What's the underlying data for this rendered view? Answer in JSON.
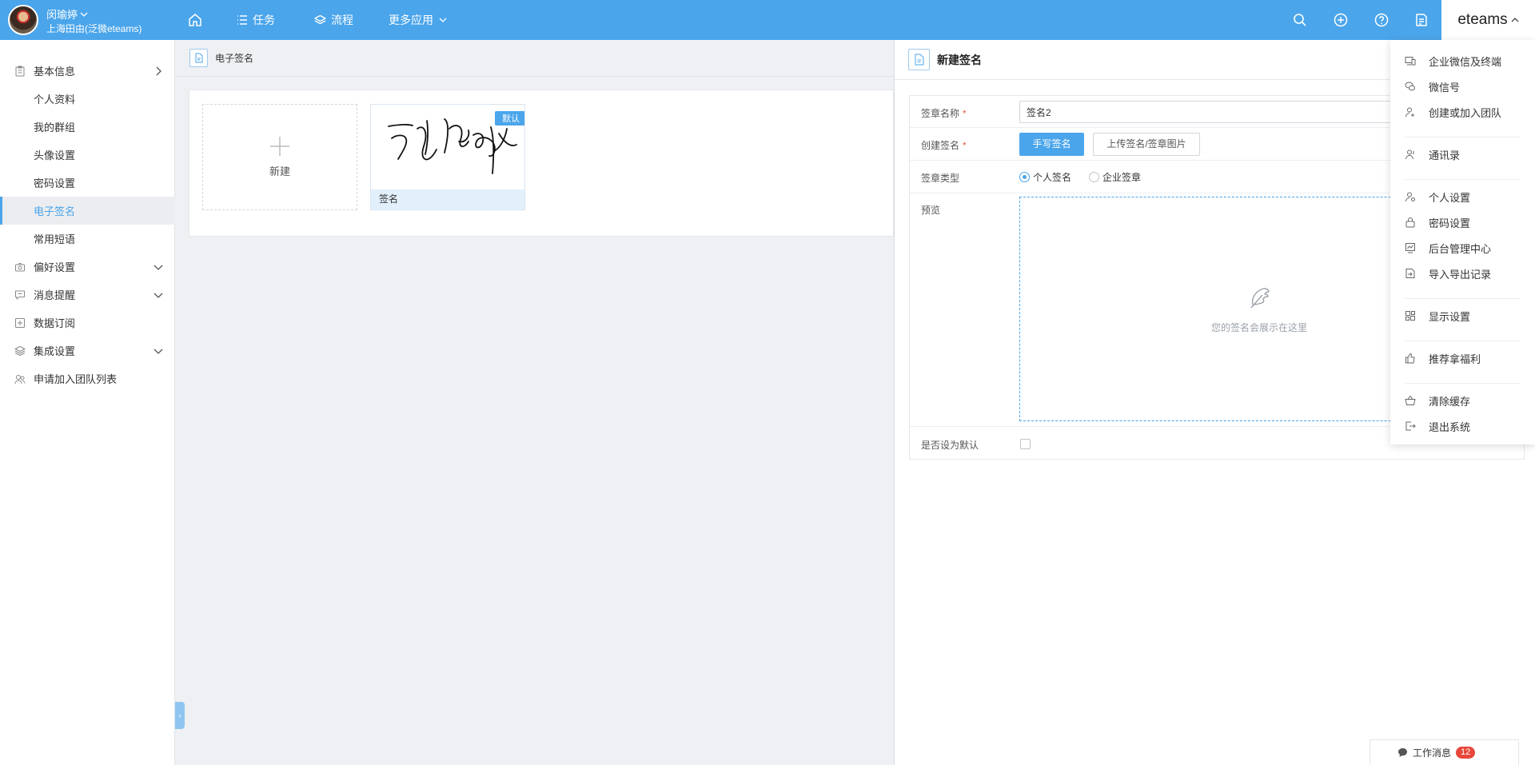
{
  "header": {
    "user_name": "闵瑜婷",
    "user_org": "上海田由(泛微eteams)",
    "nav": {
      "tasks": "任务",
      "process": "流程",
      "more_apps": "更多应用"
    },
    "brand": "eteams"
  },
  "sidebar": {
    "items": [
      {
        "label": "基本信息"
      },
      {
        "label": "个人资料"
      },
      {
        "label": "我的群组"
      },
      {
        "label": "头像设置"
      },
      {
        "label": "密码设置"
      },
      {
        "label": "电子签名"
      },
      {
        "label": "常用短语"
      },
      {
        "label": "偏好设置"
      },
      {
        "label": "消息提醒"
      },
      {
        "label": "数据订阅"
      },
      {
        "label": "集成设置"
      },
      {
        "label": "申请加入团队列表"
      }
    ]
  },
  "main": {
    "breadcrumb": "电子签名",
    "new_card_label": "新建",
    "signature": {
      "name": "签名",
      "badge": "默认"
    }
  },
  "panel": {
    "title": "新建签名",
    "fields": {
      "name_label": "签章名称",
      "name_value": "签名2",
      "create_label": "创建签名",
      "btn_handwrite": "手写签名",
      "btn_upload": "上传签名/签章图片",
      "type_label": "签章类型",
      "type_personal": "个人签名",
      "type_company": "企业签章",
      "preview_label": "预览",
      "preview_placeholder": "您的签名会展示在这里",
      "default_label": "是否设为默认"
    }
  },
  "menu": {
    "items": [
      {
        "label": "企业微信及终端"
      },
      {
        "label": "微信号"
      },
      {
        "label": "创建或加入团队"
      },
      {
        "label": "通讯录"
      },
      {
        "label": "个人设置"
      },
      {
        "label": "密码设置"
      },
      {
        "label": "后台管理中心"
      },
      {
        "label": "导入导出记录"
      },
      {
        "label": "显示设置"
      },
      {
        "label": "推荐拿福利"
      },
      {
        "label": "清除缓存"
      },
      {
        "label": "退出系统"
      }
    ]
  },
  "messages": {
    "label": "工作消息",
    "count": "12"
  },
  "colors": {
    "accent": "#4aa5eb",
    "badge_red": "#e8473b"
  }
}
